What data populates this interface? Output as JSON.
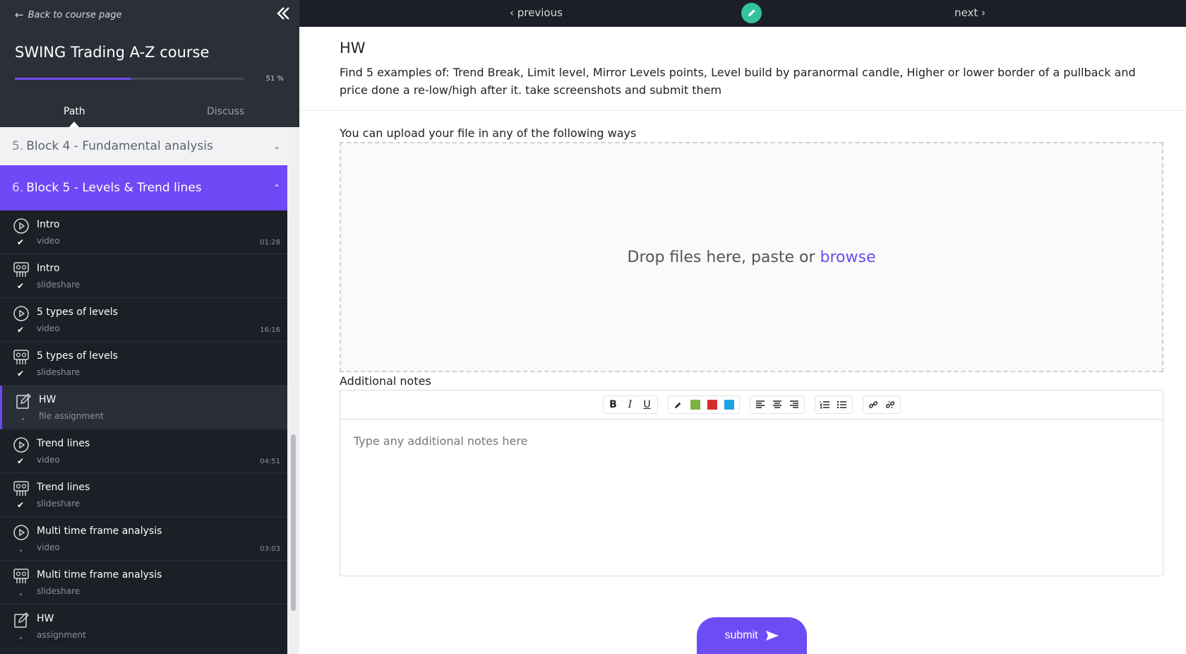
{
  "sidebar": {
    "back_label": "Back to course page",
    "course_title": "SWING Trading A-Z course",
    "progress": 0.51,
    "progress_label": "51 %",
    "tabs": {
      "path": "Path",
      "discuss": "Discuss"
    },
    "blocks": [
      {
        "number": "5.",
        "title": "Block 4 - Fundamental analysis",
        "expanded": false
      },
      {
        "number": "6.",
        "title": "Block 5 - Levels & Trend lines",
        "expanded": true
      }
    ],
    "lessons": [
      {
        "title": "Intro",
        "type": "video",
        "duration": "01:28",
        "icon": "play-circle-icon",
        "done": true
      },
      {
        "title": "Intro",
        "type": "slideshare",
        "duration": "",
        "icon": "slides-icon",
        "done": true
      },
      {
        "title": "5 types of levels",
        "type": "video",
        "duration": "16:16",
        "icon": "play-circle-icon",
        "done": true
      },
      {
        "title": "5 types of levels",
        "type": "slideshare",
        "duration": "",
        "icon": "slides-icon",
        "done": true
      },
      {
        "title": "HW",
        "type": "file assignment",
        "duration": "",
        "icon": "assignment-icon",
        "done": false,
        "active": true
      },
      {
        "title": "Trend lines",
        "type": "video",
        "duration": "04:51",
        "icon": "play-circle-icon",
        "done": true
      },
      {
        "title": "Trend lines",
        "type": "slideshare",
        "duration": "",
        "icon": "slides-icon",
        "done": true
      },
      {
        "title": "Multi time frame analysis",
        "type": "video",
        "duration": "03:03",
        "icon": "play-circle-icon",
        "done": false
      },
      {
        "title": "Multi time frame analysis",
        "type": "slideshare",
        "duration": "",
        "icon": "slides-icon",
        "done": false
      },
      {
        "title": "HW",
        "type": "assignment",
        "duration": "",
        "icon": "assignment-icon",
        "done": false
      }
    ]
  },
  "topbar": {
    "previous": "‹ previous",
    "next": "next ›"
  },
  "main": {
    "title": "HW",
    "description": "Find 5 examples of: Trend Break, Limit level, Mirror Levels points, Level build by paranormal candle, Higher or lower border of a pullback and price done a re-low/high after it. take screenshots and submit them",
    "upload_label": "You can upload your file in any of the following ways",
    "drop_text": "Drop files here, paste or",
    "browse_text": "browse",
    "notes_label": "Additional notes",
    "notes_placeholder": "Type any additional notes here",
    "submit_label": "submit"
  },
  "colors": {
    "accent": "#6e4cf5",
    "sidebar_bg": "#1b1f26",
    "edit_badge": "#34c2a0",
    "swatches": [
      "#7cb342",
      "#d32f2f",
      "#1fa2e6"
    ]
  }
}
